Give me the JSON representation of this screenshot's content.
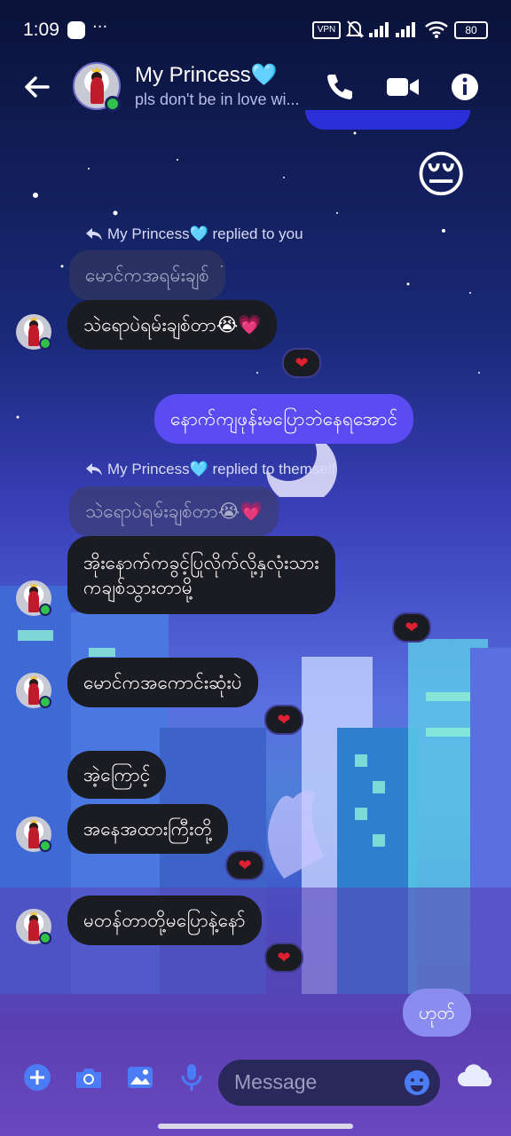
{
  "status_bar": {
    "time": "1:09",
    "overflow": "···",
    "vpn": "VPN",
    "battery": "80"
  },
  "header": {
    "title": "My Princess🩵",
    "subtitle": "pls don't be in love wi..."
  },
  "messages": {
    "emoji": "😔",
    "reply1_note": "My Princess🩵 replied to you",
    "reply1_quote": "မောင်ကအရမ်းချစ်",
    "reply1_text": "သဲရောပဲရမ်းချစ်တာ😭💗",
    "sent1": "နောက်ကျဖုန်းမပြောဘဲနေရအောင်",
    "reply2_note": "My Princess🩵 replied to themself",
    "reply2_quote": "သဲရောပဲရမ်းချစ်တာ😭💗",
    "reply2_line1": "အိုးနောက်ကခွင့်ပြုလိုက်လို့နှလုံးသား",
    "reply2_line2": "ကချစ်သွားတာမို့",
    "msg3": "မောင်ကအကောင်းဆုံးပဲ",
    "msg4": "အဲ့ကြောင့်",
    "msg5": "အနေအထားကြီးတို့",
    "msg6": "မတန်တာတို့မပြောနဲ့နော်",
    "sent2": "ဟုတ်",
    "heart": "❤"
  },
  "composer": {
    "placeholder": "Message"
  },
  "colors": {
    "accent": "#5a4bf2",
    "bubble_dark": "#1b1b22",
    "online": "#31c24a"
  },
  "icons": [
    "back-arrow-icon",
    "phone-icon",
    "video-camera-icon",
    "info-icon",
    "plus-icon",
    "camera-icon",
    "image-icon",
    "microphone-icon",
    "emoji-icon",
    "cloud-icon",
    "messenger-icon",
    "vpn-icon",
    "mute-icon",
    "signal-icon",
    "wifi-icon",
    "battery-icon"
  ]
}
